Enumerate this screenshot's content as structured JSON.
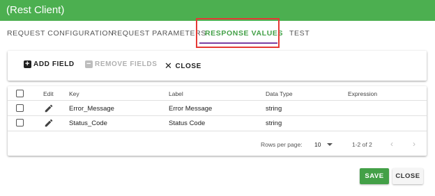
{
  "window": {
    "title": "(Rest Client)"
  },
  "tabs": [
    {
      "label": "REQUEST CONFIGURATION"
    },
    {
      "label": "REQUEST PARAMETERS"
    },
    {
      "label": "RESPONSE VALUES"
    },
    {
      "label": "TEST"
    }
  ],
  "active_tab": "RESPONSE VALUES",
  "toolbar": {
    "add_label": "ADD FIELD",
    "remove_label": "REMOVE FIELDS",
    "close_label": "CLOSE"
  },
  "table": {
    "columns": [
      "Edit",
      "Key",
      "Label",
      "Data Type",
      "Expression"
    ],
    "rows": [
      {
        "key": "Error_Message",
        "label": "Error Message",
        "data_type": "string",
        "expression": ""
      },
      {
        "key": "Status_Code",
        "label": "Status Code",
        "data_type": "string",
        "expression": ""
      }
    ],
    "footer": {
      "rows_per_page_label": "Rows per page:",
      "rows_per_page_value": "10",
      "range": "1-2 of 2"
    }
  },
  "actions": {
    "save_label": "SAVE",
    "close_label": "CLOSE"
  },
  "colors": {
    "title_bar": "#4caf50",
    "accent_green": "#43a047",
    "tab_underline": "#7b3fa3",
    "highlight": "#e53935"
  },
  "icons": [
    "plus-box-icon",
    "minus-box-icon",
    "close-icon",
    "pencil-icon",
    "dropdown-arrow-icon",
    "chevron-left-icon",
    "chevron-right-icon"
  ]
}
